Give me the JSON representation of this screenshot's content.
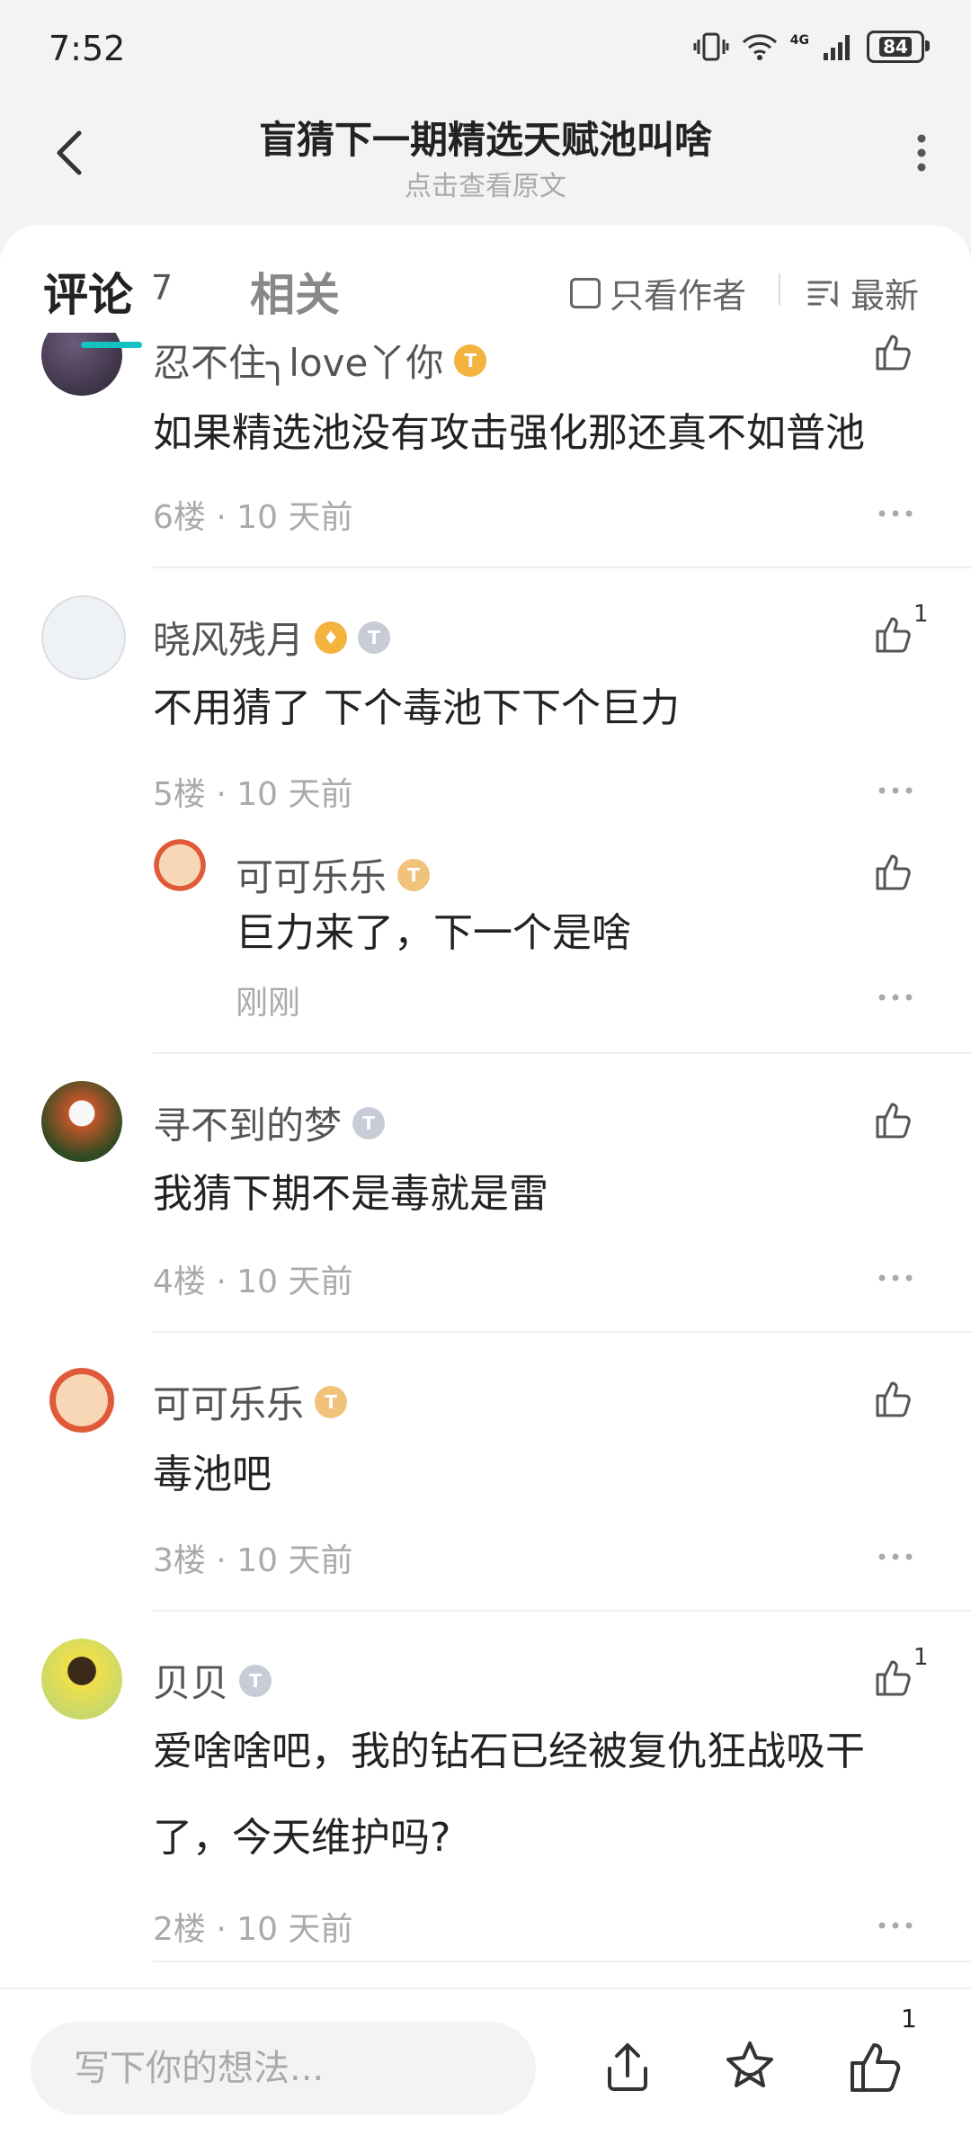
{
  "status": {
    "time": "7:52",
    "battery": "84",
    "network": "4G"
  },
  "header": {
    "title": "盲猜下一期精选天赋池叫啥",
    "subtitle": "点击查看原文"
  },
  "tabs": {
    "comments_label": "评论",
    "comments_count": "7",
    "related_label": "相关",
    "author_only": "只看作者",
    "sort": "最新"
  },
  "comments": [
    {
      "name": "忍不住╮love丫你",
      "text": "如果精选池没有攻击强化那还真不如普池",
      "meta": "6楼 · 10 天前"
    },
    {
      "name": "晓风残月",
      "text": "不用猜了 下个毒池下下个巨力",
      "meta": "5楼 · 10 天前",
      "likes": "1"
    },
    {
      "name": "可可乐乐",
      "text": "巨力来了，下一个是啥",
      "meta": "刚刚"
    },
    {
      "name": "寻不到的梦",
      "text": "我猜下期不是毒就是雷",
      "meta": "4楼 · 10 天前"
    },
    {
      "name": "可可乐乐",
      "text": "毒池吧",
      "meta": "3楼 · 10 天前"
    },
    {
      "name": "贝贝",
      "text": "爱啥啥吧，我的钻石已经被复仇狂战吸干了，今天维护吗?",
      "meta": "2楼 · 10 天前",
      "likes": "1"
    }
  ],
  "bottom": {
    "placeholder": "写下你的想法...",
    "likes": "1"
  }
}
